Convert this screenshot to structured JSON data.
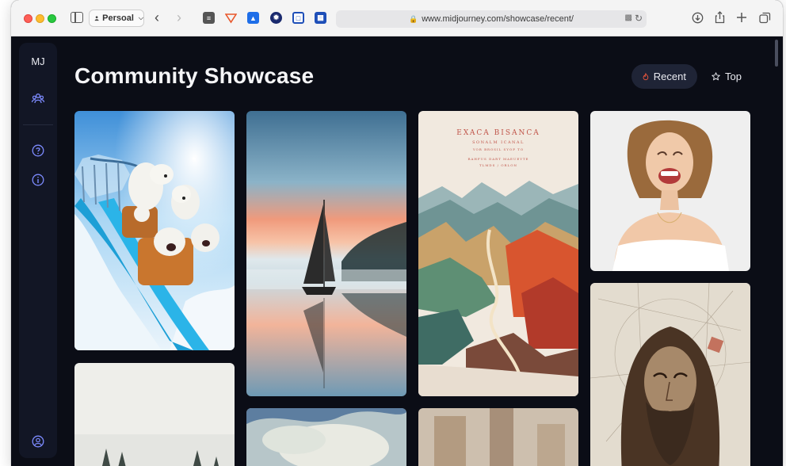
{
  "browser": {
    "profile_label": "Persoal",
    "url": "www.midjourney.com/showcase/recent/"
  },
  "sidebar": {
    "logo": "MJ",
    "icons": [
      "community-icon",
      "help-icon",
      "info-icon",
      "account-icon"
    ]
  },
  "header": {
    "title": "Community Showcase",
    "recent_label": "Recent",
    "top_label": "Top"
  },
  "poster": {
    "title": "EXACA BISANCA",
    "subtitle": "SONALM ICANAL",
    "line1": "YOR  BROSIL SYOP  TO",
    "line2": "RAHFUS DART MAEUEYTE",
    "line3": "TLMDS  /  ORLON"
  },
  "gallery": {
    "images": [
      "polar-bears-roller-coaster",
      "sailboat-reflection-sunset",
      "mountain-river-poster",
      "laughing-woman-portrait",
      "winter-trees",
      "stormy-sky-painting",
      "abstract-brown-painting",
      "jesus-portrait-sketch"
    ]
  },
  "colors": {
    "page_bg": "#0b0d16",
    "sidebar_bg": "#121625",
    "pill_bg": "#1f2436",
    "recent_icon": "#ff5a3c"
  }
}
